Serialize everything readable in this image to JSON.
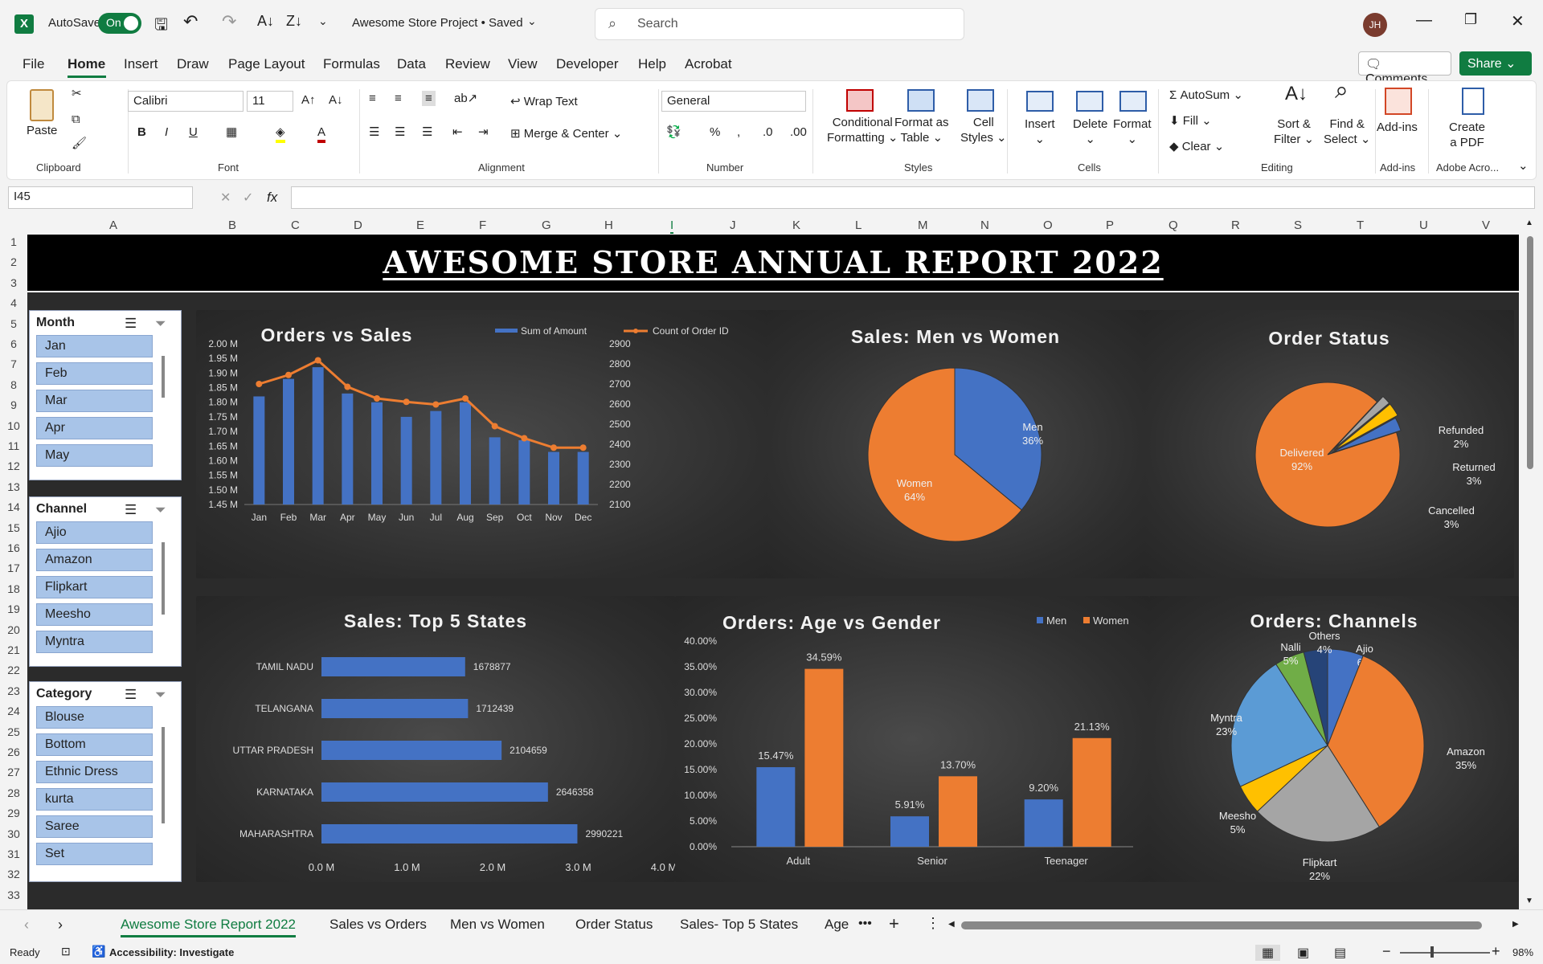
{
  "window": {
    "autosave_label": "AutoSave",
    "autosave_state": "On",
    "title": "Awesome Store Project • Saved",
    "search_placeholder": "Search",
    "user_initials": "JH"
  },
  "menu": [
    "File",
    "Home",
    "Insert",
    "Draw",
    "Page Layout",
    "Formulas",
    "Data",
    "Review",
    "View",
    "Developer",
    "Help",
    "Acrobat"
  ],
  "menu_active": "Home",
  "comments_label": "Comments",
  "share_label": "Share",
  "ribbon": {
    "paste": "Paste",
    "clipboard": "Clipboard",
    "font_name": "Calibri",
    "font_size": "11",
    "font_group": "Font",
    "wrap_text": "Wrap Text",
    "merge_center": "Merge & Center",
    "alignment": "Alignment",
    "number_format": "General",
    "number_group": "Number",
    "cond_format": [
      "Conditional",
      "Formatting"
    ],
    "format_table": [
      "Format as",
      "Table"
    ],
    "cell_styles": [
      "Cell",
      "Styles"
    ],
    "styles_group": "Styles",
    "insert": "Insert",
    "delete": "Delete",
    "format": "Format",
    "cells_group": "Cells",
    "autosum": "AutoSum",
    "fill": "Fill",
    "clear": "Clear",
    "sort_filter": [
      "Sort &",
      "Filter"
    ],
    "find_select": [
      "Find &",
      "Select"
    ],
    "editing_group": "Editing",
    "addins": "Add-ins",
    "addins_group": "Add-ins",
    "create_pdf": [
      "Create",
      "a PDF"
    ],
    "adobe_group": "Adobe Acro..."
  },
  "formula": {
    "name_box": "I45",
    "fx": "fx",
    "content": ""
  },
  "columns": [
    "A",
    "B",
    "C",
    "D",
    "E",
    "F",
    "G",
    "H",
    "I",
    "J",
    "K",
    "L",
    "M",
    "N",
    "O",
    "P",
    "Q",
    "R",
    "S",
    "T",
    "U",
    "V"
  ],
  "rows": [
    "1",
    "2",
    "3",
    "4",
    "5",
    "6",
    "7",
    "8",
    "9",
    "10",
    "11",
    "12",
    "13",
    "14",
    "15",
    "16",
    "17",
    "18",
    "19",
    "20",
    "21",
    "22",
    "23",
    "24",
    "25",
    "26",
    "27",
    "28",
    "29",
    "30",
    "31",
    "32",
    "33"
  ],
  "report_title": "AWESOME STORE ANNUAL REPORT 2022",
  "slicers": [
    {
      "title": "Month",
      "items": [
        "Jan",
        "Feb",
        "Mar",
        "Apr",
        "May"
      ]
    },
    {
      "title": "Channel",
      "items": [
        "Ajio",
        "Amazon",
        "Flipkart",
        "Meesho",
        "Myntra"
      ]
    },
    {
      "title": "Category",
      "items": [
        "Blouse",
        "Bottom",
        "Ethnic Dress",
        "kurta",
        "Saree",
        "Set"
      ]
    }
  ],
  "colors": {
    "blue": "#4472c4",
    "orange": "#ed7d31",
    "gray": "#a5a5a5",
    "yellow": "#ffc000",
    "lightblue": "#5b9bd5",
    "green": "#70ad47",
    "navy": "#264478",
    "excel_green": "#107c41"
  },
  "chart_data": [
    {
      "type": "bar+line",
      "title": "Orders vs Sales",
      "categories": [
        "Jan",
        "Feb",
        "Mar",
        "Apr",
        "May",
        "Jun",
        "Jul",
        "Aug",
        "Sep",
        "Oct",
        "Nov",
        "Dec"
      ],
      "series": [
        {
          "name": "Sum of Amount",
          "type": "bar",
          "axis": "left",
          "values": [
            1.82,
            1.88,
            1.92,
            1.83,
            1.8,
            1.75,
            1.77,
            1.8,
            1.68,
            1.67,
            1.63,
            1.63
          ]
        },
        {
          "name": "Count of Order ID",
          "type": "line",
          "axis": "right",
          "values": [
            2700,
            2745,
            2818,
            2686,
            2628,
            2611,
            2598,
            2628,
            2490,
            2430,
            2383,
            2383
          ]
        }
      ],
      "yleft_ticks": [
        "2.00 M",
        "1.95 M",
        "1.90 M",
        "1.85 M",
        "1.80 M",
        "1.75 M",
        "1.70 M",
        "1.65 M",
        "1.60 M",
        "1.55 M",
        "1.50 M",
        "1.45 M"
      ],
      "yleft_range": [
        1.45,
        2.0
      ],
      "yright_ticks": [
        "2900",
        "2800",
        "2700",
        "2600",
        "2500",
        "2400",
        "2300",
        "2200",
        "2100"
      ],
      "yright_range": [
        2100,
        2900
      ]
    },
    {
      "type": "pie",
      "title": "Sales: Men vs Women",
      "labels": [
        "Men",
        "Women"
      ],
      "values": [
        36,
        64
      ],
      "display": [
        "36%",
        "64%"
      ]
    },
    {
      "type": "pie",
      "title": "Order Status",
      "labels": [
        "Delivered",
        "Refunded",
        "Returned",
        "Cancelled"
      ],
      "values": [
        92,
        2,
        3,
        3
      ],
      "display": [
        "92%",
        "2%",
        "3%",
        "3%"
      ]
    },
    {
      "type": "bar",
      "orientation": "horizontal",
      "title": "Sales: Top 5 States",
      "categories": [
        "TAMIL NADU",
        "TELANGANA",
        "UTTAR PRADESH",
        "KARNATAKA",
        "MAHARASHTRA"
      ],
      "values": [
        1678877,
        1712439,
        2104659,
        2646358,
        2990221
      ],
      "xticks": [
        "0.0 M",
        "1.0 M",
        "2.0 M",
        "3.0 M",
        "4.0 M"
      ],
      "xlim": [
        0,
        4000000
      ]
    },
    {
      "type": "bar",
      "title": "Orders: Age vs Gender",
      "categories": [
        "Adult",
        "Senior",
        "Teenager"
      ],
      "series": [
        {
          "name": "Men",
          "values": [
            15.47,
            5.91,
            9.2
          ],
          "labels": [
            "15.47%",
            "5.91%",
            "9.20%"
          ]
        },
        {
          "name": "Women",
          "values": [
            34.59,
            13.7,
            21.13
          ],
          "labels": [
            "34.59%",
            "13.70%",
            "21.13%"
          ]
        }
      ],
      "yticks": [
        "40.00%",
        "35.00%",
        "30.00%",
        "25.00%",
        "20.00%",
        "15.00%",
        "10.00%",
        "5.00%",
        "0.00%"
      ],
      "ylim": [
        0,
        40
      ]
    },
    {
      "type": "pie",
      "title": "Orders: Channels",
      "labels": [
        "Ajio",
        "Amazon",
        "Flipkart",
        "Meesho",
        "Myntra",
        "Nalli",
        "Others"
      ],
      "values": [
        6,
        35,
        22,
        5,
        23,
        5,
        4
      ],
      "display": [
        "6%",
        "35%",
        "22%",
        "5%",
        "23%",
        "5%",
        "4%"
      ]
    }
  ],
  "sheet_tabs": [
    "Awesome Store Report 2022",
    "Sales vs Orders",
    "Men vs Women",
    "Order Status",
    "Sales- Top 5 States",
    "Age"
  ],
  "status": {
    "ready": "Ready",
    "accessibility": "Accessibility: Investigate",
    "zoom": "98%"
  }
}
